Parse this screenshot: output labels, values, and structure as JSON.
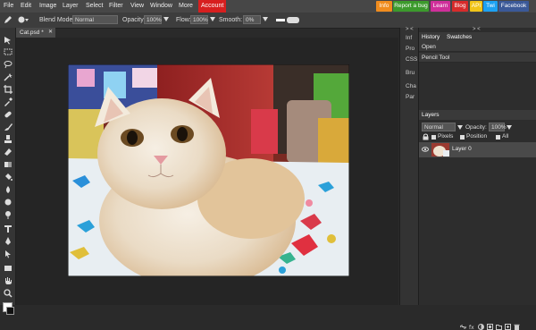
{
  "menubar": {
    "items": [
      "File",
      "Edit",
      "Image",
      "Layer",
      "Select",
      "Filter",
      "View",
      "Window",
      "More"
    ],
    "account": "Account",
    "links": [
      {
        "label": "Info",
        "color": "#f08c1e"
      },
      {
        "label": "Report a bug",
        "color": "#3c9a2c"
      },
      {
        "label": "Learn",
        "color": "#cf2f9a"
      },
      {
        "label": "Blog",
        "color": "#d72b2b"
      },
      {
        "label": "API",
        "color": "#f0c419"
      },
      {
        "label": "Twi",
        "color": "#1da1f2"
      },
      {
        "label": "Facebook",
        "color": "#3b5998"
      }
    ]
  },
  "options": {
    "blend_label": "Blend Mode:",
    "blend_value": "Normal",
    "opacity_label": "Opacity:",
    "opacity_value": "100%",
    "flow_label": "Flow:",
    "flow_value": "100%",
    "smooth_label": "Smooth:",
    "smooth_value": "0%"
  },
  "document": {
    "tab_title": "Cat.psd *",
    "close": "✕"
  },
  "mini_panel": [
    "Inf",
    "Pro",
    "CSS",
    "Bru",
    "Cha",
    "Par"
  ],
  "history": {
    "tab_history": "History",
    "tab_swatches": "Swatches",
    "entries": [
      "Open",
      "Pencil Tool"
    ]
  },
  "layers": {
    "tab": "Layers",
    "blend": "Normal",
    "opacity_label": "Opacity:",
    "opacity_value": "100%",
    "lock_pixels": "Pixels",
    "lock_position": "Position",
    "lock_all": "All",
    "layer_name": "Layer 0"
  }
}
